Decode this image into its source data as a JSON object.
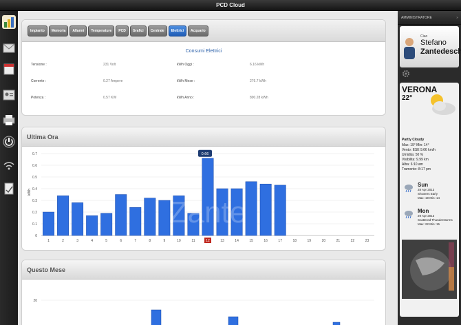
{
  "window": {
    "title": "PCD Cloud"
  },
  "tabs": [
    "Impianto",
    "Memoria",
    "Allarmi",
    "Temperature",
    "PCD",
    "Grafici",
    "Centrale",
    "Elettrici",
    "Acquario"
  ],
  "active_tab_index": 7,
  "consumi": {
    "title": "Consumi Elettrici",
    "rows": [
      {
        "label": "Tensione :",
        "value": "231 Volt",
        "label2": "kWh Oggi :",
        "value2": "6.16 kWh"
      },
      {
        "label": "Corrente :",
        "value": "0.27 Ampere",
        "label2": "kWh Mese :",
        "value2": "276.7 kWh"
      },
      {
        "label": "Potenza :",
        "value": "0.57 KW",
        "label2": "kWh Anno :",
        "value2": "890.28 kWh"
      }
    ]
  },
  "ultima_ora": {
    "title": "Ultima Ora",
    "watermark": "Zante"
  },
  "questo_mese": {
    "title": "Questo Mese"
  },
  "chart_data": [
    {
      "type": "bar",
      "title": "Ultima Ora",
      "ylabel": "kWh",
      "ylim": [
        0,
        0.7
      ],
      "yticks": [
        "0",
        "0.1",
        "0.2",
        "0.3",
        "0.4",
        "0.5",
        "0.6",
        "0.7"
      ],
      "categories": [
        "1",
        "2",
        "3",
        "4",
        "5",
        "6",
        "7",
        "8",
        "9",
        "10",
        "11",
        "12",
        "13",
        "14",
        "15",
        "16",
        "17",
        "18",
        "19",
        "20",
        "21",
        "22",
        "23"
      ],
      "values": [
        0.2,
        0.34,
        0.28,
        0.17,
        0.19,
        0.35,
        0.24,
        0.32,
        0.3,
        0.34,
        0.19,
        0.66,
        0.4,
        0.4,
        0.46,
        0.44,
        0.43,
        null,
        null,
        null,
        null,
        null,
        null
      ],
      "highlight_index": 11,
      "highlight_label": "0.66",
      "color": "#2f6fe0"
    },
    {
      "type": "bar",
      "title": "Questo Mese",
      "ylim": [
        0,
        20
      ],
      "yticks": [
        "20"
      ],
      "values": [],
      "color": "#2f6fe0"
    }
  ],
  "sidebar_right": {
    "header": "AMMINISTRATORE",
    "greeting": "Ciao",
    "first_name": "Stefano",
    "last_name": "Zantedeschi",
    "city": "VERONA",
    "temp": "22°",
    "condition": "Partly Cloudy",
    "details": [
      "Max: 19° Min: 14°",
      "Vento: ESE 9.66 km/h",
      "Umidita: 50 %",
      "Visibilita: 9.99 km",
      "Alba: 6:10 am",
      "Tramonto: 8:17 pm"
    ],
    "forecast": [
      {
        "day": "Sun",
        "date": "28 Apr 2013",
        "desc": "Showers Early",
        "minmax": "Max: 19 Min: 14"
      },
      {
        "day": "Mon",
        "date": "29 Apr 2013",
        "desc": "Scattered Thunderstorms",
        "minmax": "Max: 22 Min: 15"
      }
    ]
  },
  "colors": {
    "accent": "#2f6fe0",
    "highlight_badge": "#1e3c72",
    "highlight_tick": "#c0281f"
  }
}
